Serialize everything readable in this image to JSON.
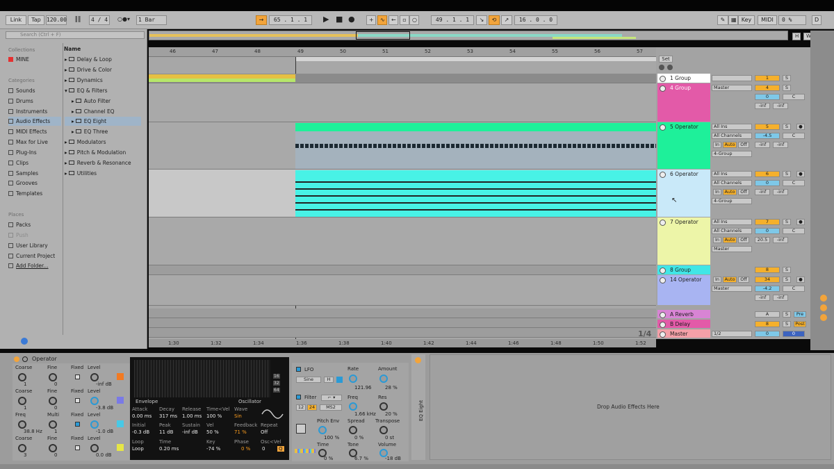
{
  "transport": {
    "link": "Link",
    "tap": "Tap",
    "tempo": "120.00",
    "sig": "4 / 4",
    "quantize": "1 Bar",
    "pos1": "65 .  1 .  1",
    "pos2": "49 .  1 .  1",
    "len": "16 .  0 .  0",
    "key": "Key",
    "midi": "MIDI",
    "cpu": "0 %",
    "cpu_letter": "D"
  },
  "browser": {
    "search_placeholder": "Search (Ctrl + F)",
    "collections_header": "Collections",
    "collection_item": "MINE",
    "categories_header": "Categories",
    "categories": [
      "Sounds",
      "Drums",
      "Instruments",
      "Audio Effects",
      "MIDI Effects",
      "Max for Live",
      "Plug-Ins",
      "Clips",
      "Samples",
      "Grooves",
      "Templates"
    ],
    "places_header": "Places",
    "places": [
      "Packs",
      "Push",
      "User Library",
      "Current Project",
      "Add Folder..."
    ],
    "name_header": "Name",
    "items": [
      "Delay & Loop",
      "Drive & Color",
      "Dynamics",
      "EQ & Filters",
      "Auto Filter",
      "Channel EQ",
      "EQ Eight",
      "EQ Three",
      "Modulators",
      "Pitch & Modulation",
      "Reverb & Resonance",
      "Utilities"
    ]
  },
  "arrangement": {
    "bars": [
      "46",
      "47",
      "48",
      "49",
      "50",
      "51",
      "52",
      "53",
      "54",
      "55",
      "56",
      "57"
    ],
    "times": [
      "1:30",
      "1:32",
      "1:34",
      "1:36",
      "1:38",
      "1:40",
      "1:42",
      "1:44",
      "1:46",
      "1:48",
      "1:50",
      "1:52"
    ],
    "zoom": "1/4",
    "set": "Set",
    "hw_h": "H",
    "hw_w": "W"
  },
  "tracks": [
    {
      "name": "1 Group",
      "color": "#ffffff",
      "vol": "1",
      "solo": "S"
    },
    {
      "name": "4 Group",
      "color": "#e35aa8",
      "routing": "Master",
      "vol": "4",
      "pan": "0",
      "l": "-inf",
      "r": "-inf",
      "solo": "S",
      "c": "C"
    },
    {
      "name": "5 Operator",
      "color": "#1ef09a",
      "in": "All Ins",
      "ch": "All Channels",
      "vol": "5",
      "pan": "-4.5",
      "l": "-inf",
      "r": "-inf",
      "routing": "4-Group",
      "solo": "S",
      "c": "C"
    },
    {
      "name": "6 Operator",
      "color": "#c9e9f9",
      "in": "All Ins",
      "ch": "All Channels",
      "vol": "6",
      "pan": "0",
      "l": "-inf",
      "r": "-inf",
      "routing": "4-Group",
      "solo": "S",
      "c": "C"
    },
    {
      "name": "7 Operator",
      "color": "#edf5a8",
      "in": "All Ins",
      "ch": "All Channels",
      "vol": "7",
      "pan": "0",
      "l": "20.5",
      "r": "-inf",
      "routing": "Master",
      "solo": "S",
      "c": "C"
    },
    {
      "name": "8 Group",
      "color": "#41e6e6",
      "vol": "8",
      "solo": "S"
    },
    {
      "name": "14 Operator",
      "color": "#a8b4f2",
      "routing": "Master",
      "vol": "34",
      "pan": "-4.2",
      "l": "-inf",
      "r": "-inf",
      "solo": "S",
      "c": "C"
    },
    {
      "name": "A Reverb",
      "color": "#d884d4",
      "vol": "A",
      "solo": "S",
      "pre": "Pre"
    },
    {
      "name": "B Delay",
      "color": "#e35aa8",
      "vol": "8",
      "solo": "S",
      "pre": "Post"
    },
    {
      "name": "Master",
      "color": "#f4a0a8",
      "routing": "1/2",
      "vol": "0",
      "pan": "0"
    }
  ],
  "io_labels": {
    "in": "In",
    "auto": "Auto",
    "off": "Off"
  },
  "device": {
    "name": "Operator",
    "osc_rows": [
      {
        "coarse": "1",
        "fine": "0",
        "level": "-inf dB"
      },
      {
        "coarse": "1",
        "fine": "0",
        "level": "-3.8 dB"
      },
      {
        "freq": "38.8 Hz",
        "multi": "1",
        "level": "-1.0 dB"
      },
      {
        "coarse": "3",
        "fine": "0",
        "level": "0.0 dB"
      }
    ],
    "labels": {
      "coarse": "Coarse",
      "fine": "Fine",
      "fixed": "Fixed",
      "level": "Level",
      "freq": "Freq",
      "multi": "Multi"
    },
    "envelope": {
      "title": "Envelope",
      "attack_k": "Attack",
      "attack": "0.00 ms",
      "decay_k": "Decay",
      "decay": "317 ms",
      "release_k": "Release",
      "release": "1.00 ms",
      "time_k": "Time<Vel",
      "time": "100 %",
      "initial_k": "Initial",
      "initial": "-0.3 dB",
      "peak_k": "Peak",
      "peak": "11 dB",
      "sustain_k": "Sustain",
      "sustain": "-inf dB",
      "vel_k": "Vel",
      "vel": "50 %",
      "loop_k": "Loop",
      "loop": "Loop",
      "time2_k": "Time",
      "time2": "0.20 ms",
      "key_k": "Key",
      "key": "-74 %"
    },
    "oscillator": {
      "title": "Oscillator",
      "wave_k": "Wave",
      "wave": "Sin",
      "feedback_k": "Feedback",
      "feedback": "71 %",
      "repeat_k": "Repeat",
      "repeat": "Off",
      "phase_k": "Phase",
      "phase": "0 %",
      "oscvel_k": "Osc<Vel",
      "oscvel": "0",
      "q": "Q"
    },
    "scr_labels": [
      "16",
      "32",
      "64"
    ],
    "lfo": {
      "title": "LFO",
      "wave": "Sine",
      "hw": "H",
      "rate_k": "Rate",
      "rate": "121.96",
      "amount_k": "Amount",
      "amount": "28 %"
    },
    "filter": {
      "title": "Filter",
      "n1": "12",
      "n2": "24",
      "mode": "MS2",
      "freq_k": "Freq",
      "freq": "1.66 kHz",
      "res_k": "Res",
      "res": "20 %"
    },
    "bottom": {
      "pitchenv_k": "Pitch Env",
      "pitchenv": "100 %",
      "spread_k": "Spread",
      "spread": "0 %",
      "transpose_k": "Transpose",
      "transpose": "0 st",
      "time_k": "Time",
      "time": "0 %",
      "tone_k": "Tone",
      "tone": "6.7 %",
      "volume_k": "Volume",
      "volume": "-18 dB"
    },
    "eq_label": "EQ Eight",
    "drop": "Drop Audio Effects Here"
  },
  "colors": {
    "accent": "#f2a43b",
    "clip_green": "#1ef09a",
    "clip_cyan": "#48f2e6",
    "group_pink": "#e35aa8"
  }
}
